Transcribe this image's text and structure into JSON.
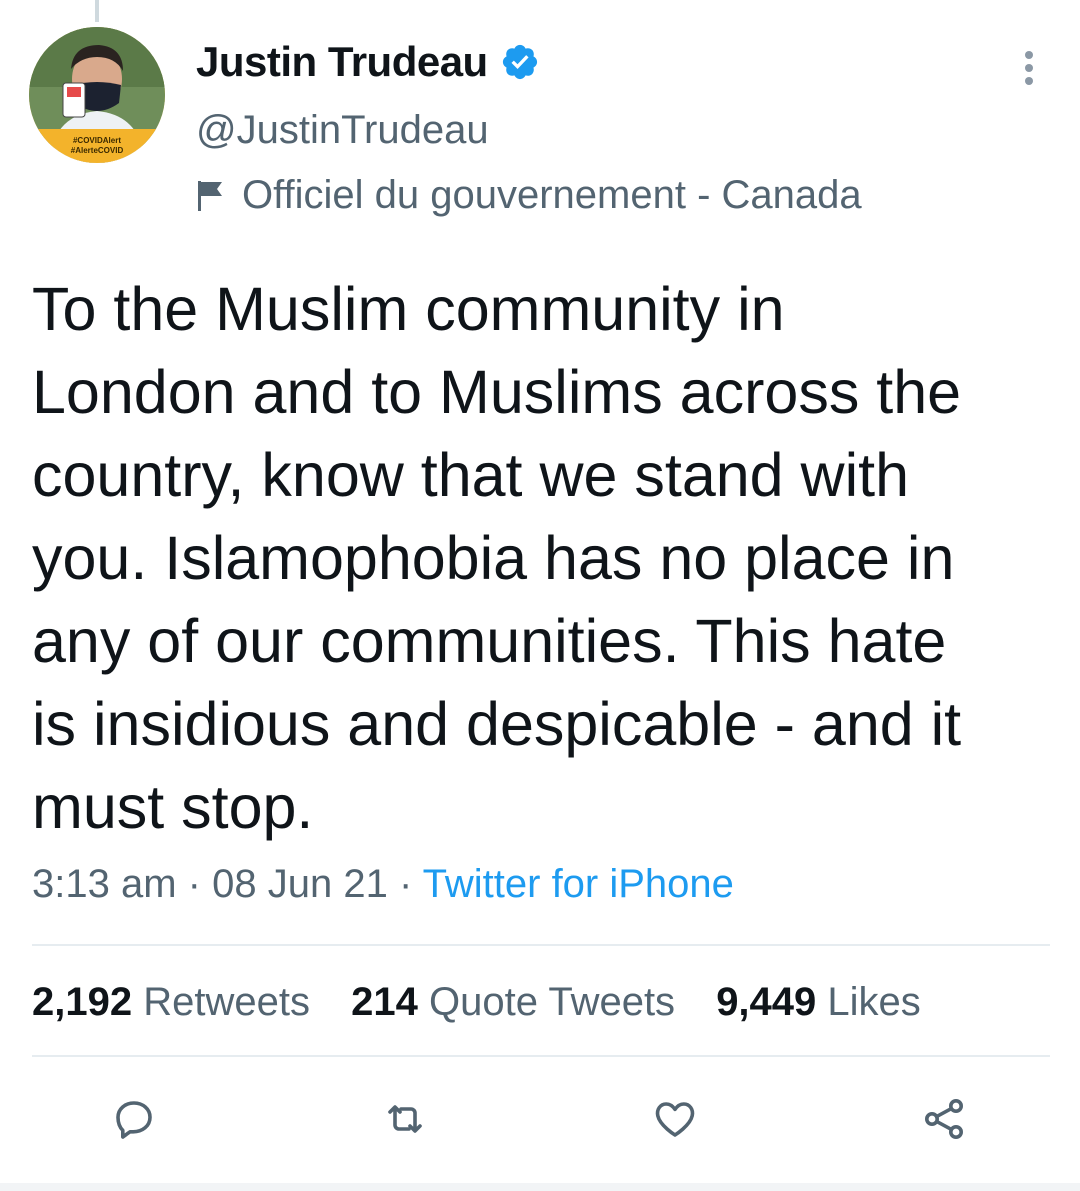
{
  "user": {
    "display_name": "Justin Trudeau",
    "handle": "@JustinTrudeau",
    "label": "Officiel du gouvernement - Canada",
    "avatar_badge_lines": [
      "#COVIDAlert",
      "#AlerteCOVID"
    ]
  },
  "tweet": {
    "text": "To the Muslim community in\nLondon and to Muslims across the\ncountry, know that we stand with\nyou. Islamophobia has no place in\nany of our communities. This hate\nis insidious and despicable - and it\nmust stop.",
    "time": "3:13 am",
    "date": "08 Jun 21",
    "separator": "·",
    "source": "Twitter for iPhone"
  },
  "stats": {
    "retweets_count": "2,192",
    "retweets_label": "Retweets",
    "quotes_count": "214",
    "quotes_label": "Quote Tweets",
    "likes_count": "9,449",
    "likes_label": "Likes"
  },
  "icons": {
    "more": "more-vertical-icon",
    "verified": "verified-badge-icon",
    "label": "flag-icon",
    "reply": "reply-icon",
    "retweet": "retweet-icon",
    "like": "heart-icon",
    "share": "share-icon"
  },
  "colors": {
    "accent": "#1d9bf0",
    "text_primary": "#0f1419",
    "text_secondary": "#536471",
    "divider": "#e6ecf0",
    "avatar_badge": "#f3b32b"
  }
}
